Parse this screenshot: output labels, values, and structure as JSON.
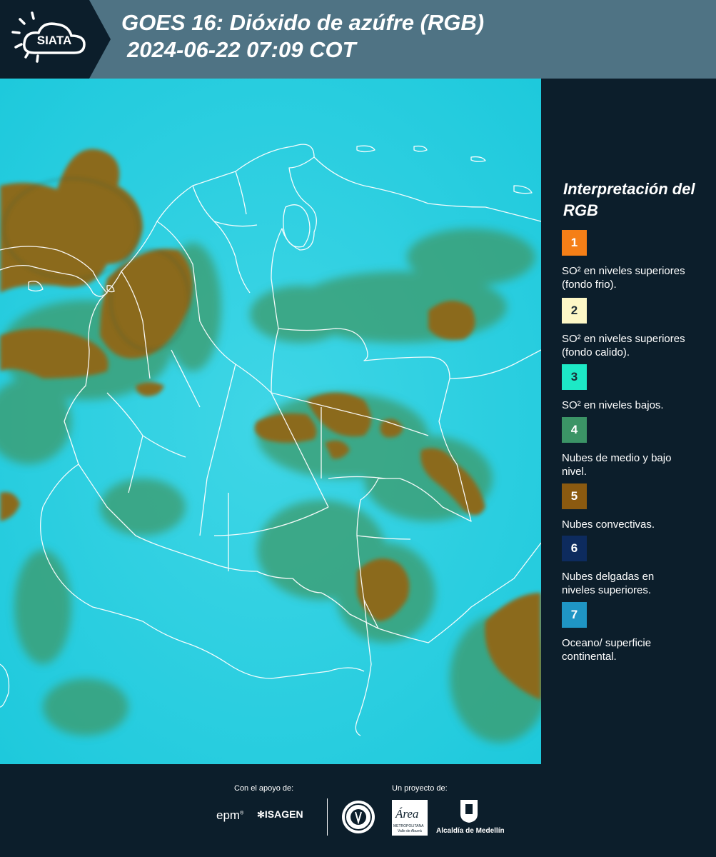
{
  "header": {
    "logo_text": "SIATA",
    "title_line1": "GOES 16: Dióxido de azúfre (RGB)",
    "title_line2": "2024-06-22 07:09 COT",
    "background_color": "#4f7384"
  },
  "legend": {
    "title": "Interpretación del RGB",
    "items": [
      {
        "number": "1",
        "color": "#f57f17",
        "text": "SO² en niveles superiores (fondo frio)."
      },
      {
        "number": "2",
        "color": "#fdf7c6",
        "text": "SO² en niveles superiores (fondo calido)."
      },
      {
        "number": "3",
        "color": "#1de9c6",
        "text": "SO² en niveles bajos."
      },
      {
        "number": "4",
        "color": "#3b9466",
        "text": "Nubes de medio y bajo nivel."
      },
      {
        "number": "5",
        "color": "#8b5a10",
        "text": "Nubes convectivas."
      },
      {
        "number": "6",
        "color": "#0d2b5e",
        "text": "Nubes delgadas en niveles superiores."
      },
      {
        "number": "7",
        "color": "#1f95c4",
        "text": "Oceano/ superficie continental."
      }
    ]
  },
  "footer": {
    "support_label": "Con el apoyo de:",
    "project_label": "Un proyecto de:",
    "sponsors": [
      "epm",
      "ISAGEN"
    ],
    "area_logo_name": "Área",
    "area_logo_line1": "METROPOLITANA",
    "area_logo_line2": "Valle de Aburrá",
    "alcaldia_label": "Alcaldía de Medellín"
  },
  "colors": {
    "background": "#0c1e2b",
    "map_base": "#2ed0e0",
    "convective_clouds": "#8b6a1e",
    "mid_low_clouds": "#3e9a6a"
  }
}
